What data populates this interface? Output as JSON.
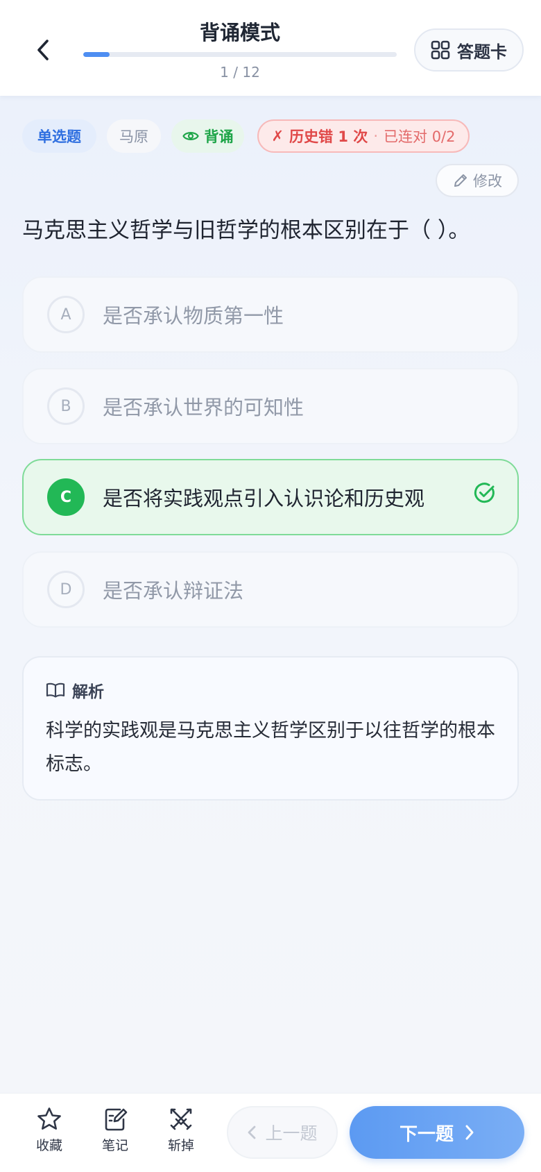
{
  "header": {
    "title": "背诵模式",
    "progress_text": "1 / 12",
    "progress_fraction": 0.0833,
    "answer_card_label": "答题卡",
    "back_icon": "chevron-left-icon",
    "answer_card_icon": "grid-icon"
  },
  "tags": {
    "type": "单选题",
    "subject": "马原",
    "mode": "背诵",
    "history_mark": "✗",
    "history_wrong": "历史错 1 次",
    "history_sep": "·",
    "history_streak": "已连对 0/2"
  },
  "edit_label": "修改",
  "question": "马克思主义哲学与旧哲学的根本区别在于（ ）。",
  "options": [
    {
      "letter": "A",
      "text": "是否承认物质第一性",
      "correct": false
    },
    {
      "letter": "B",
      "text": "是否承认世界的可知性",
      "correct": false
    },
    {
      "letter": "C",
      "text": "是否将实践观点引入认识论和历史观",
      "correct": true
    },
    {
      "letter": "D",
      "text": "是否承认辩证法",
      "correct": false
    }
  ],
  "explanation": {
    "title": "解析",
    "body": "科学的实践观是马克思主义哲学区别于以往哲学的根本标志。"
  },
  "bottom": {
    "favorite": "收藏",
    "note": "笔记",
    "cut": "斩掉",
    "prev": "上一题",
    "next": "下一题"
  },
  "colors": {
    "accent": "#4e8ef2",
    "correct": "#22b856",
    "error": "#e04848"
  }
}
